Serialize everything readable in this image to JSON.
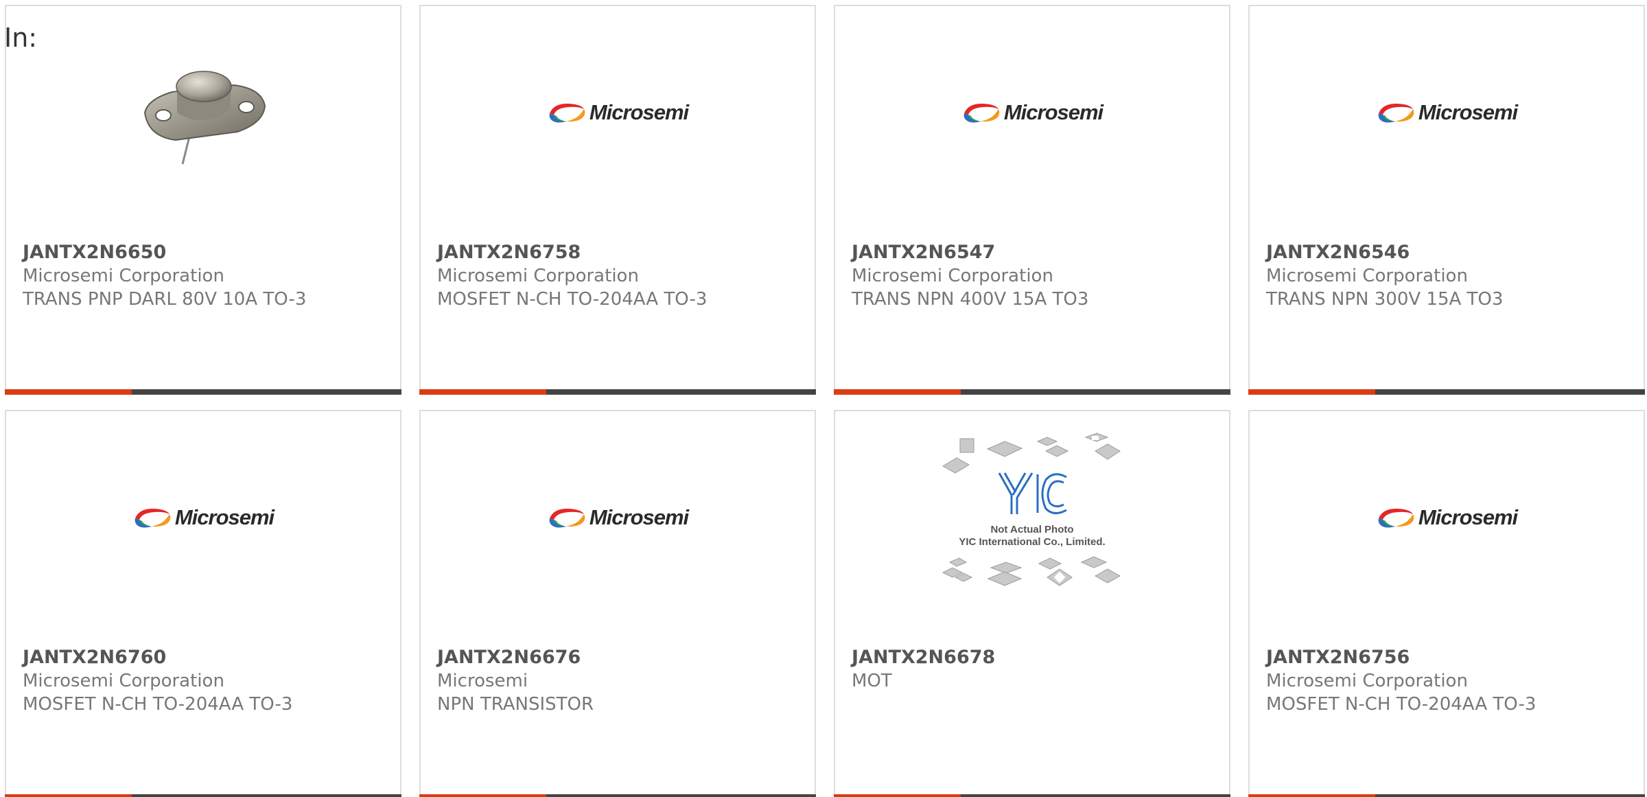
{
  "header": {
    "label": "In:"
  },
  "colors": {
    "accent": "#dc3c14",
    "bar_dark": "#444444",
    "border": "#dddddd"
  },
  "logos": {
    "microsemi": "Microsemi"
  },
  "placeholder": {
    "brand": "YIC",
    "line1": "Not Actual Photo",
    "line2": "YIC International Co., Limited."
  },
  "products": [
    {
      "part": "JANTX2N6650",
      "manufacturer": "Microsemi Corporation",
      "description": "TRANS PNP DARL 80V 10A TO-3",
      "image": "to3-package-photo"
    },
    {
      "part": "JANTX2N6758",
      "manufacturer": "Microsemi Corporation",
      "description": "MOSFET N-CH TO-204AA TO-3",
      "image": "microsemi-logo"
    },
    {
      "part": "JANTX2N6547",
      "manufacturer": "Microsemi Corporation",
      "description": "TRANS NPN 400V 15A TO3",
      "image": "microsemi-logo"
    },
    {
      "part": "JANTX2N6546",
      "manufacturer": "Microsemi Corporation",
      "description": "TRANS NPN 300V 15A TO3",
      "image": "microsemi-logo"
    },
    {
      "part": "JANTX2N6760",
      "manufacturer": "Microsemi Corporation",
      "description": "MOSFET N-CH TO-204AA TO-3",
      "image": "microsemi-logo"
    },
    {
      "part": "JANTX2N6676",
      "manufacturer": "Microsemi",
      "description": "NPN TRANSISTOR",
      "image": "microsemi-logo"
    },
    {
      "part": "JANTX2N6678",
      "manufacturer": "MOT",
      "description": "",
      "image": "yic-placeholder"
    },
    {
      "part": "JANTX2N6756",
      "manufacturer": "Microsemi Corporation",
      "description": "MOSFET N-CH TO-204AA TO-3",
      "image": "microsemi-logo"
    }
  ]
}
